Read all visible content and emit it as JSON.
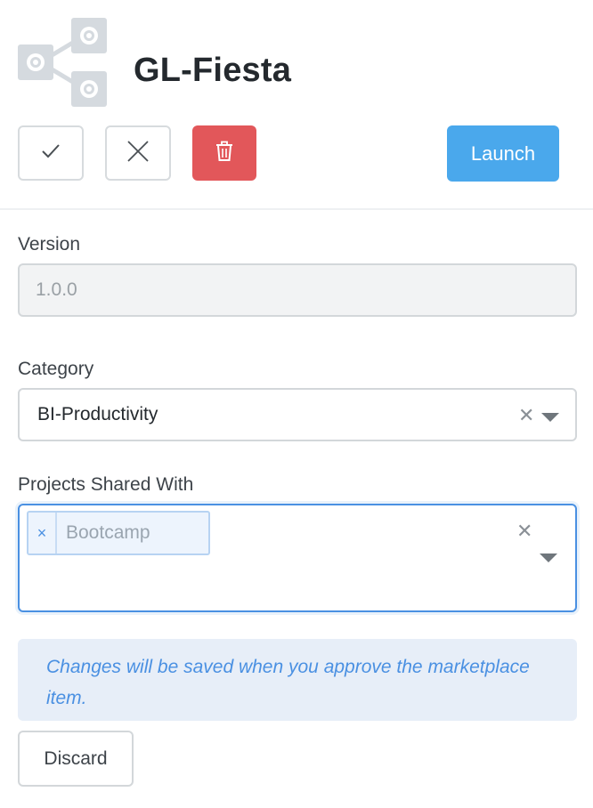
{
  "app": {
    "title": "GL-Fiesta",
    "icon": "gear-network-icon"
  },
  "toolbar": {
    "approve_icon": "checkmark-icon",
    "reject_icon": "close-icon",
    "delete_icon": "trash-icon",
    "delete_color": "#e2575a",
    "launch_label": "Launch",
    "launch_color": "#4aa8ec"
  },
  "form": {
    "version": {
      "label": "Version",
      "value": "1.0.0"
    },
    "category": {
      "label": "Category",
      "value": "BI-Productivity"
    },
    "projects": {
      "label": "Projects Shared With",
      "tags": [
        "Bootcamp"
      ]
    }
  },
  "notice": {
    "text": "Changes will be saved when you approve the marketplace item."
  },
  "actions": {
    "discard_label": "Discard"
  },
  "colors": {
    "accent": "#4a90e2",
    "info_bg": "#e7eef8"
  }
}
